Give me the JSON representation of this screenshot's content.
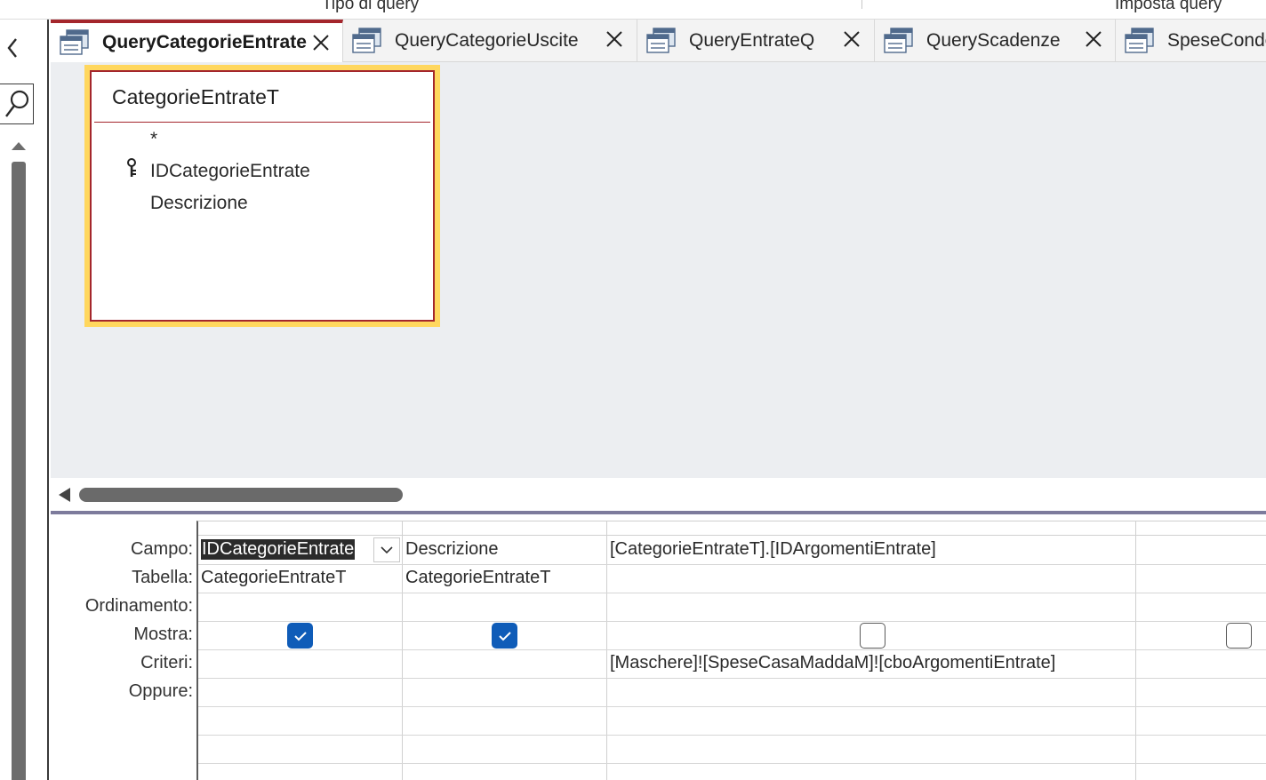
{
  "ribbon": {
    "group_left": "Tipo di query",
    "group_right": "Imposta query"
  },
  "tabs": [
    {
      "label": "QueryCategorieEntrate",
      "active": true,
      "icon": "query-icon"
    },
    {
      "label": "QueryCategorieUscite",
      "active": false,
      "icon": "query-icon"
    },
    {
      "label": "QueryEntrateQ",
      "active": false,
      "icon": "query-icon"
    },
    {
      "label": "QueryScadenze",
      "active": false,
      "icon": "query-icon"
    },
    {
      "label": "SpeseCondo",
      "active": false,
      "icon": "query-icon"
    }
  ],
  "field_list": {
    "title": "CategorieEntrateT",
    "items": [
      "*",
      "IDCategorieEntrate",
      "Descrizione"
    ],
    "primary_key_index": 1
  },
  "qbe": {
    "row_labels": {
      "campo": "Campo:",
      "tabella": "Tabella:",
      "ordinamento": "Ordinamento:",
      "mostra": "Mostra:",
      "criteri": "Criteri:",
      "oppure": "Oppure:"
    },
    "columns": [
      {
        "campo": "IDCategorieEntrate",
        "tabella": "CategorieEntrateT",
        "ordinamento": "",
        "mostra": true,
        "criteri": "",
        "selected": true
      },
      {
        "campo": "Descrizione",
        "tabella": "CategorieEntrateT",
        "ordinamento": "",
        "mostra": true,
        "criteri": ""
      },
      {
        "campo": "[CategorieEntrateT].[IDArgomentiEntrate]",
        "tabella": "",
        "ordinamento": "",
        "mostra": false,
        "criteri": "[Maschere]![SpeseCasaMaddaM]![cboArgomentiEntrate]"
      },
      {
        "campo": "",
        "tabella": "",
        "ordinamento": "",
        "mostra": false,
        "criteri": ""
      }
    ]
  },
  "colors": {
    "accent": "#a4262c",
    "selection_outline": "#ffd75e",
    "checkbox_checked": "#0f5cb8",
    "design_background": "#eceef1"
  }
}
